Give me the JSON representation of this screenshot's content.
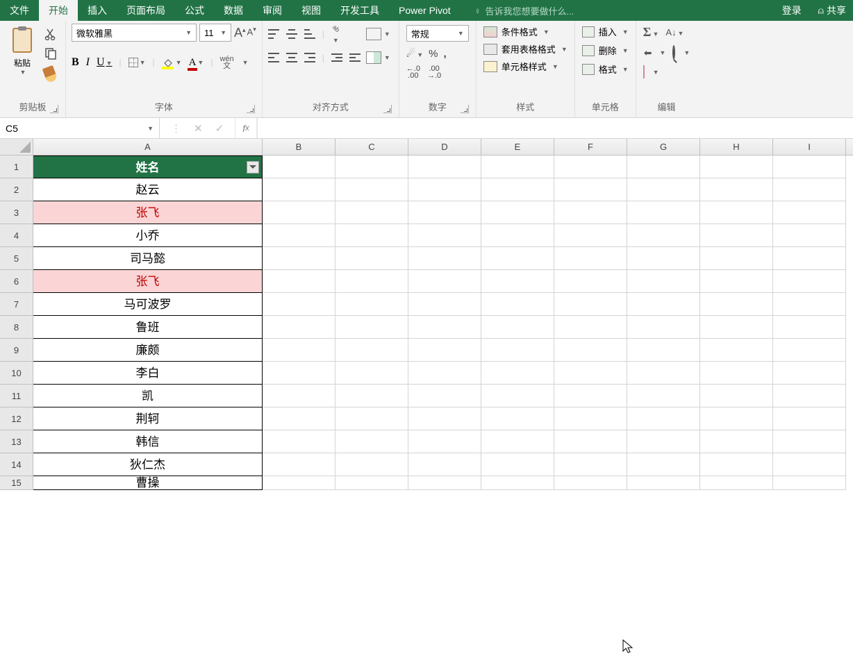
{
  "menu": {
    "file": "文件",
    "home": "开始",
    "insert": "插入",
    "layout": "页面布局",
    "formulas": "公式",
    "data": "数据",
    "review": "审阅",
    "view": "视图",
    "dev": "开发工具",
    "pp": "Power Pivot",
    "tell": "告诉我您想要做什么...",
    "login": "登录",
    "share": "共享"
  },
  "ribbon": {
    "clipboard": {
      "paste": "粘贴",
      "label": "剪贴板"
    },
    "font": {
      "name": "微软雅黑",
      "size": "11",
      "label": "字体",
      "wen": "wén",
      "wenchar": "文"
    },
    "align": {
      "label": "对齐方式"
    },
    "number": {
      "format": "常规",
      "label": "数字"
    },
    "styles": {
      "cf": "条件格式",
      "tf": "套用表格格式",
      "cs": "单元格样式",
      "label": "样式"
    },
    "cells": {
      "insert": "插入",
      "delete": "删除",
      "format": "格式",
      "label": "单元格"
    },
    "editing": {
      "label": "编辑"
    }
  },
  "formula_bar": {
    "name_box": "C5"
  },
  "grid": {
    "columns": [
      "A",
      "B",
      "C",
      "D",
      "E",
      "F",
      "G",
      "H",
      "I"
    ],
    "header_cell": "姓名",
    "rows": [
      {
        "n": 1,
        "v": "姓名",
        "header": true
      },
      {
        "n": 2,
        "v": "赵云"
      },
      {
        "n": 3,
        "v": "张飞",
        "hl": true
      },
      {
        "n": 4,
        "v": "小乔"
      },
      {
        "n": 5,
        "v": "司马懿"
      },
      {
        "n": 6,
        "v": "张飞",
        "hl": true
      },
      {
        "n": 7,
        "v": "马可波罗"
      },
      {
        "n": 8,
        "v": "鲁班"
      },
      {
        "n": 9,
        "v": "廉颇"
      },
      {
        "n": 10,
        "v": "李白"
      },
      {
        "n": 11,
        "v": "凯"
      },
      {
        "n": 12,
        "v": "荆轲"
      },
      {
        "n": 13,
        "v": "韩信"
      },
      {
        "n": 14,
        "v": "狄仁杰"
      },
      {
        "n": 15,
        "v": "曹操",
        "last": true
      }
    ]
  }
}
